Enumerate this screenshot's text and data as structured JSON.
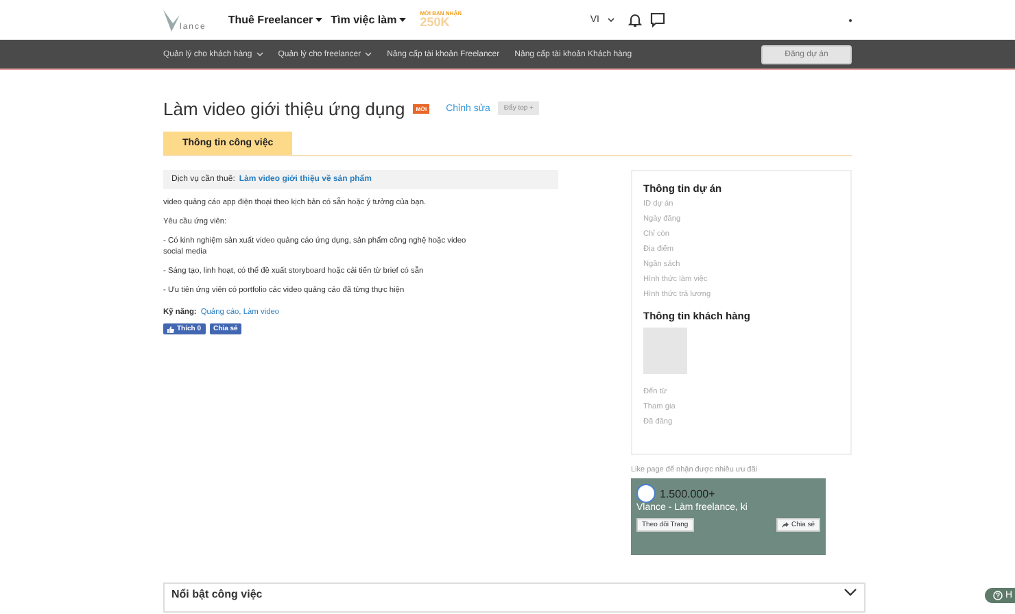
{
  "header": {
    "logo_text": "lance",
    "menu": [
      {
        "label": "Thuê Freelancer",
        "has_dropdown": true
      },
      {
        "label": "Tìm việc làm",
        "has_dropdown": true
      }
    ],
    "promo": {
      "caption": "MỜI BẠN NHẬN",
      "amount": "250K"
    },
    "language": "VI"
  },
  "subnav": {
    "items": [
      {
        "label": "Quản lý cho khách hàng",
        "has_dropdown": true
      },
      {
        "label": "Quản lý cho freelancer",
        "has_dropdown": true
      },
      {
        "label": "Nâng cấp tài khoản Freelancer",
        "has_dropdown": false
      },
      {
        "label": "Nâng cấp tài khoản Khách hàng",
        "has_dropdown": false
      }
    ],
    "post_button": "Đăng dự án"
  },
  "job": {
    "title": "Làm video giới thiệu ứng dụng",
    "badge": "MỚI",
    "edit_link": "Chỉnh sửa",
    "push_button": "Đẩy top +"
  },
  "tabs": [
    {
      "label": "Thông tin công việc",
      "selected": true
    }
  ],
  "service": {
    "label": "Dịch vụ cần thuê:",
    "value": "Làm video giới thiệu về sản phẩm"
  },
  "description": [
    "video quảng cáo app điện thoại theo kịch bản có sẵn hoặc ý tưởng của bạn.",
    "Yêu cầu ứng viên:",
    "- Có kinh nghiệm sản xuất video quảng cáo ứng dụng, sản phẩm công nghệ hoặc video social media",
    "- Sáng tạo, linh hoạt, có thể đề xuất storyboard hoặc cải tiến từ brief có sẵn",
    "- Ưu tiên ứng viên có portfolio các video quảng cáo đã từng thực hiện"
  ],
  "skills": {
    "label": "Kỹ năng:",
    "value": "Quảng cáo, Làm video"
  },
  "social": {
    "like": "Thích 0",
    "share": "Chia sẻ"
  },
  "sidebar": {
    "project_title": "Thông tin dự án",
    "project_fields": [
      "ID dự án",
      "Ngày đăng",
      "Chỉ còn",
      "Địa điểm",
      "Ngân sách",
      "Hình thức làm việc",
      "Hình thức trả lương"
    ],
    "client_title": "Thông tin khách hàng",
    "client_fields": [
      "Đến từ",
      "Tham gia",
      "Đã đăng"
    ]
  },
  "fanpage": {
    "caption": "Like page để nhận được nhiều ưu đãi",
    "count": "1.500.000+",
    "name": "Vlance - Làm freelance, ki",
    "follow": "Theo dõi Trang",
    "share": "Chia sẻ"
  },
  "featured": {
    "title": "Nổi bật công việc",
    "expanded": false
  },
  "help": "H"
}
